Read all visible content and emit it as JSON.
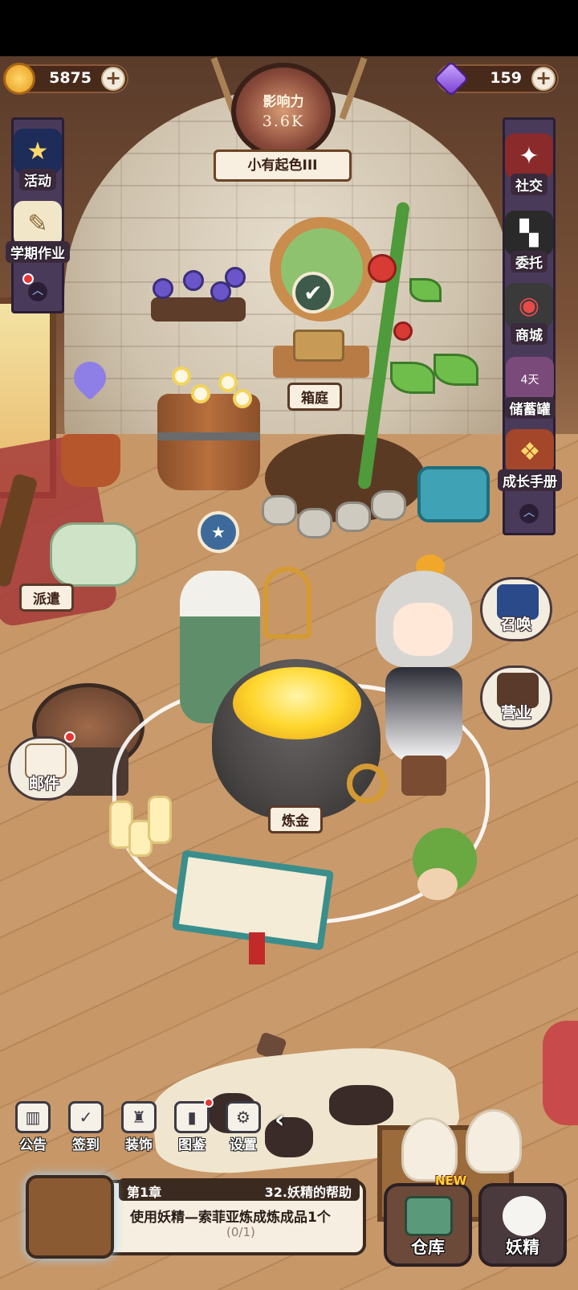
{
  "hud": {
    "coins": "5875",
    "gems": "159",
    "influence_label": "影响力",
    "influence_value": "3.6K",
    "rank": "小有起色III"
  },
  "left_menu": [
    {
      "label": "活动",
      "icon": "activity-calendar-icon"
    },
    {
      "label": "学期作业",
      "icon": "homework-scroll-icon"
    }
  ],
  "right_menu": [
    {
      "label": "社交",
      "icon": "social-icon"
    },
    {
      "label": "委托",
      "icon": "commission-icon"
    },
    {
      "label": "商城",
      "icon": "shop-icon"
    },
    {
      "label": "储蓄罐",
      "icon": "piggy-bank-icon",
      "badge": "4天"
    },
    {
      "label": "成长手册",
      "icon": "growth-manual-icon"
    }
  ],
  "scene": {
    "garden_label": "箱庭",
    "dispatch_label": "派遣",
    "alchemy_label": "炼金",
    "summon_label": "召唤",
    "business_label": "营业",
    "mail_label": "邮件"
  },
  "bottom_bar": [
    {
      "label": "公告",
      "icon": "announcement-icon"
    },
    {
      "label": "签到",
      "icon": "checkin-icon"
    },
    {
      "label": "装饰",
      "icon": "decoration-icon"
    },
    {
      "label": "图鉴",
      "icon": "encyclopedia-icon"
    },
    {
      "label": "设置",
      "icon": "settings-gear-icon"
    }
  ],
  "quest": {
    "chapter": "第1章",
    "title": "32.妖精的帮助",
    "description": "使用妖精—索菲亚炼成炼成品1个",
    "progress": "(0/1)"
  },
  "warehouse": {
    "label": "仓库",
    "tag": "NEW"
  },
  "fairy": {
    "label": "妖精"
  },
  "colors": {
    "accent": "#4a3a5a",
    "notify": "#e83434"
  }
}
